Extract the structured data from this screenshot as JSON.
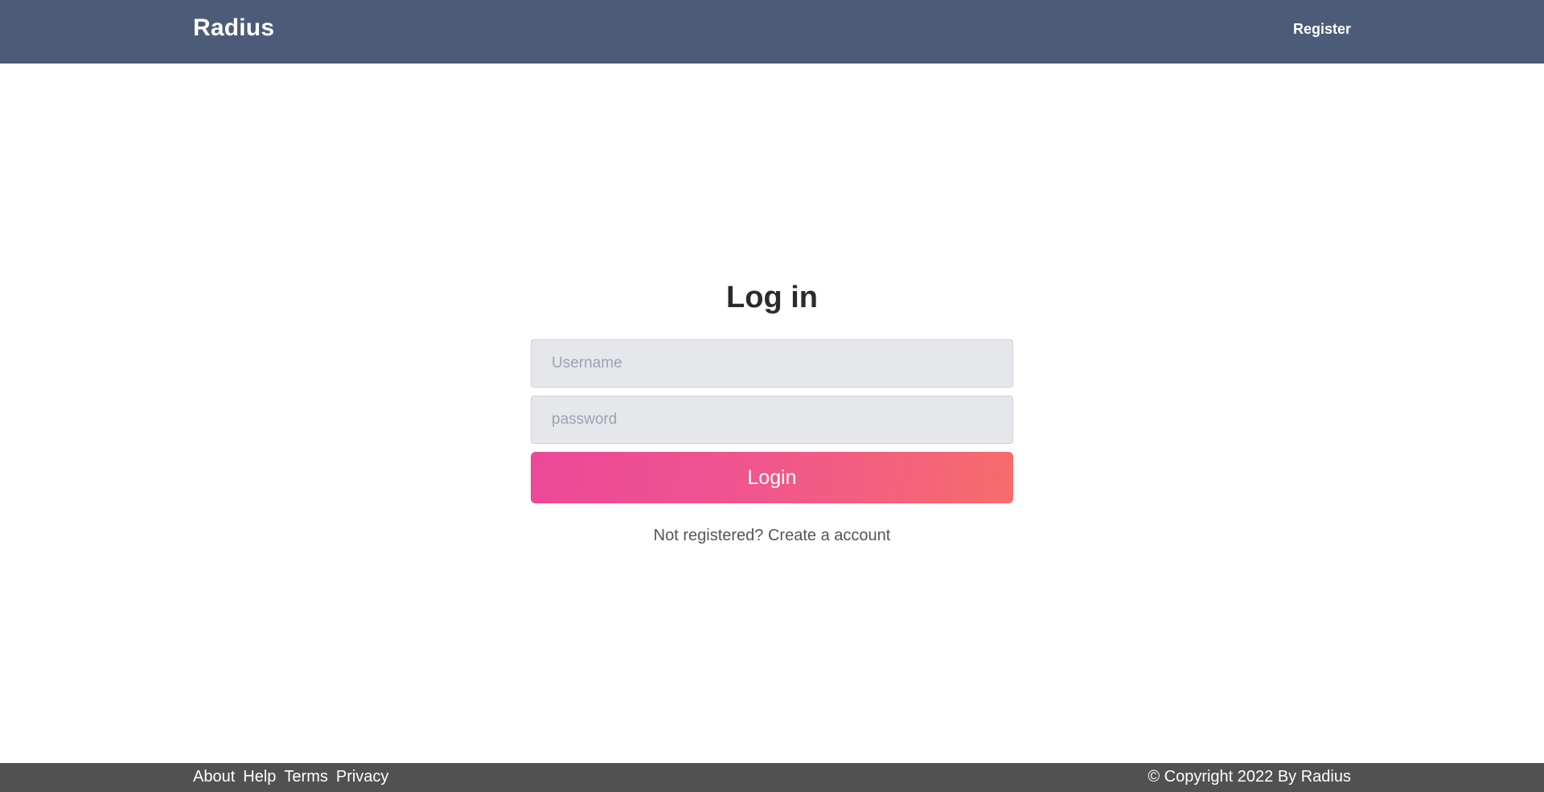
{
  "header": {
    "brand": "Radius",
    "register_link": "Register",
    "background_color": "#4c5c78"
  },
  "login": {
    "title": "Log in",
    "username": {
      "value": "",
      "placeholder": "Username"
    },
    "password": {
      "value": "",
      "placeholder": "password"
    },
    "submit_label": "Login",
    "gradient_colors": [
      "#ec4899",
      "#f76c6c"
    ],
    "signup_prompt": "Not registered?",
    "signup_link": "Create a account"
  },
  "footer": {
    "links": [
      "About",
      "Help",
      "Terms",
      "Privacy"
    ],
    "copyright": "© Copyright 2022 By Radius",
    "background_color": "#515151"
  }
}
